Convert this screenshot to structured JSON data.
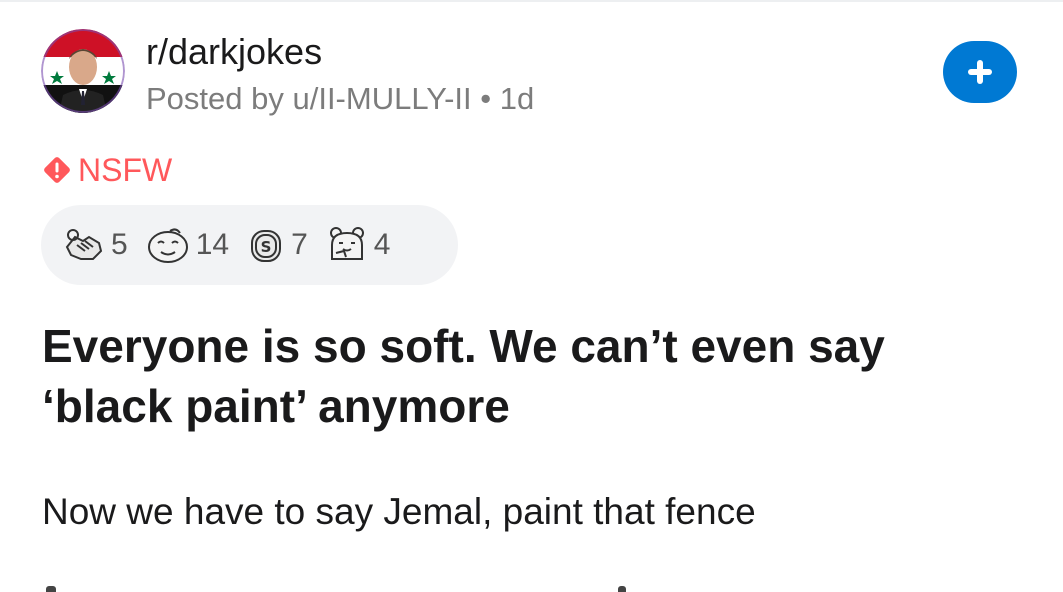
{
  "post": {
    "subreddit": "r/darkjokes",
    "meta": "Posted by u/II-MULLY-II • 1d",
    "nsfw_label": "NSFW",
    "awards": [
      {
        "icon": "handshake-award-icon",
        "count": "5"
      },
      {
        "icon": "face-award-icon",
        "count": "14"
      },
      {
        "icon": "coin-award-icon",
        "count": "7"
      },
      {
        "icon": "bear-award-icon",
        "count": "4"
      }
    ],
    "title": "Everyone is so soft. We can’t even say ‘black paint’ anymore",
    "body": "Now we have to say Jemal, paint that fence"
  },
  "colors": {
    "join_button": "#0079d3",
    "nsfw": "#ff585b",
    "award_bar": "#f2f3f5",
    "meta_text": "#7c7c7c"
  },
  "icons": {
    "join": "plus-icon",
    "nsfw": "nsfw-warning-icon",
    "avatar": "subreddit-avatar"
  }
}
